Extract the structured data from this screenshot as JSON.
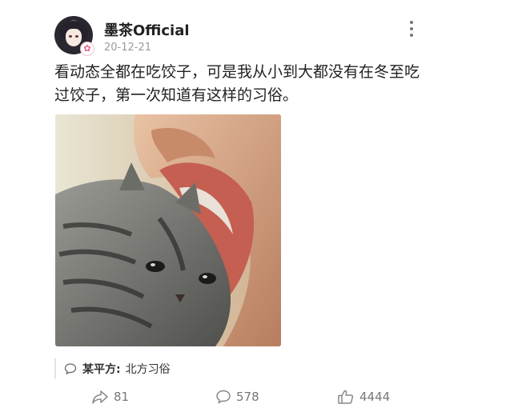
{
  "post": {
    "author": "墨茶Official",
    "date": "20-12-21",
    "text": "看动态全都在吃饺子，可是我从小到大都没有在冬至吃过饺子，第一次知道有这样的习俗。",
    "badge_icon": "badge-icon",
    "image_alt": "cat-being-bitten-meme"
  },
  "quote": {
    "name": "某平方:",
    "text": "北方习俗"
  },
  "actions": {
    "share_count": "81",
    "comment_count": "578",
    "like_count": "4444"
  }
}
